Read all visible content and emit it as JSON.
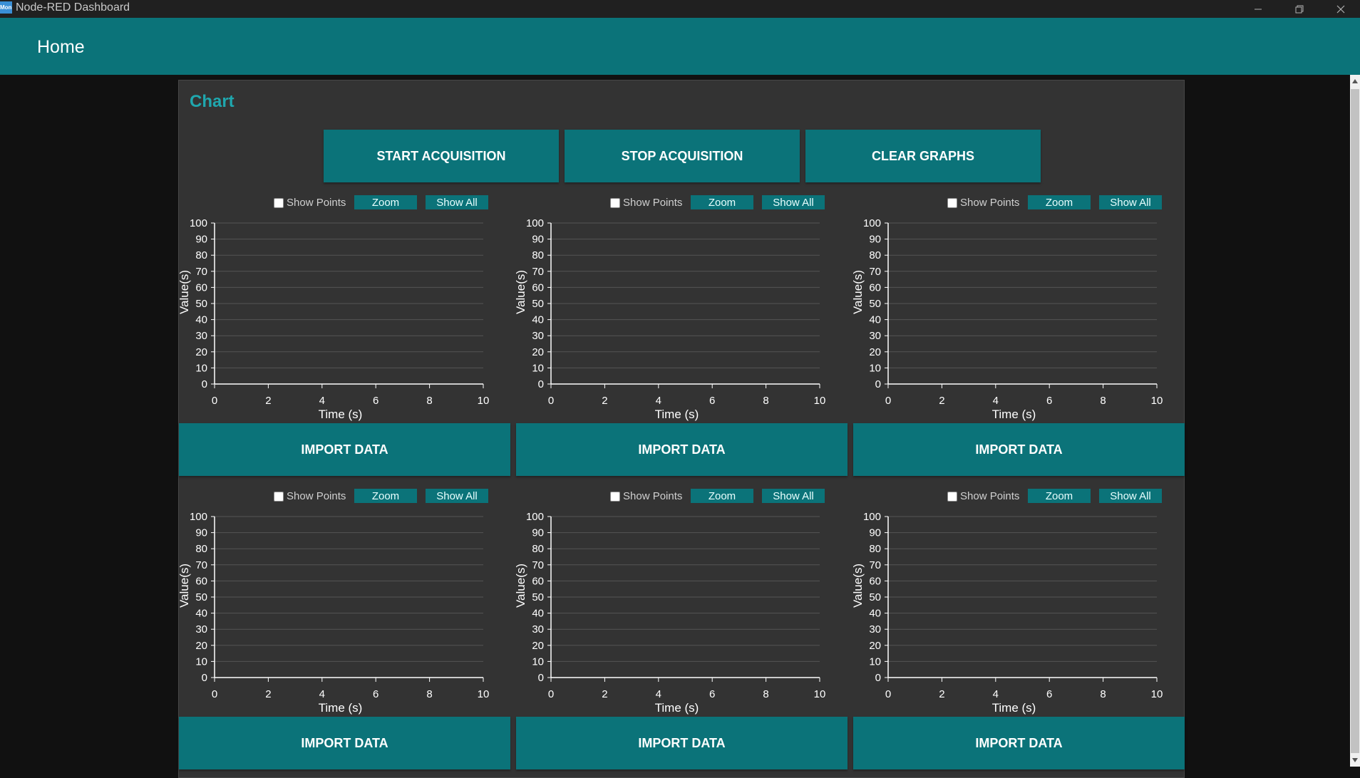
{
  "window": {
    "icon_text": "Mon",
    "title": "Node-RED Dashboard"
  },
  "header": {
    "title": "Home"
  },
  "group": {
    "title": "Chart",
    "actions": [
      {
        "label": "START ACQUISITION"
      },
      {
        "label": "STOP ACQUISITION"
      },
      {
        "label": "CLEAR GRAPHS"
      }
    ]
  },
  "chart_controls": {
    "show_points_label": "Show Points",
    "show_points_checked": false,
    "zoom_label": "Zoom",
    "show_all_label": "Show All"
  },
  "import_label": "IMPORT DATA",
  "chart_data": [
    {
      "type": "line",
      "title": "",
      "xlabel": "Time (s)",
      "ylabel": "Value(s)",
      "xlim": [
        0,
        10
      ],
      "ylim": [
        0,
        100
      ],
      "x_ticks": [
        0,
        2,
        4,
        6,
        8,
        10
      ],
      "y_ticks": [
        0,
        10,
        20,
        30,
        40,
        50,
        60,
        70,
        80,
        90,
        100
      ],
      "grid": true,
      "series": []
    },
    {
      "type": "line",
      "title": "",
      "xlabel": "Time (s)",
      "ylabel": "Value(s)",
      "xlim": [
        0,
        10
      ],
      "ylim": [
        0,
        100
      ],
      "x_ticks": [
        0,
        2,
        4,
        6,
        8,
        10
      ],
      "y_ticks": [
        0,
        10,
        20,
        30,
        40,
        50,
        60,
        70,
        80,
        90,
        100
      ],
      "grid": true,
      "series": []
    },
    {
      "type": "line",
      "title": "",
      "xlabel": "Time (s)",
      "ylabel": "Value(s)",
      "xlim": [
        0,
        10
      ],
      "ylim": [
        0,
        100
      ],
      "x_ticks": [
        0,
        2,
        4,
        6,
        8,
        10
      ],
      "y_ticks": [
        0,
        10,
        20,
        30,
        40,
        50,
        60,
        70,
        80,
        90,
        100
      ],
      "grid": true,
      "series": []
    },
    {
      "type": "line",
      "title": "",
      "xlabel": "Time (s)",
      "ylabel": "Value(s)",
      "xlim": [
        0,
        10
      ],
      "ylim": [
        0,
        100
      ],
      "x_ticks": [
        0,
        2,
        4,
        6,
        8,
        10
      ],
      "y_ticks": [
        0,
        10,
        20,
        30,
        40,
        50,
        60,
        70,
        80,
        90,
        100
      ],
      "grid": true,
      "series": []
    },
    {
      "type": "line",
      "title": "",
      "xlabel": "Time (s)",
      "ylabel": "Value(s)",
      "xlim": [
        0,
        10
      ],
      "ylim": [
        0,
        100
      ],
      "x_ticks": [
        0,
        2,
        4,
        6,
        8,
        10
      ],
      "y_ticks": [
        0,
        10,
        20,
        30,
        40,
        50,
        60,
        70,
        80,
        90,
        100
      ],
      "grid": true,
      "series": []
    },
    {
      "type": "line",
      "title": "",
      "xlabel": "Time (s)",
      "ylabel": "Value(s)",
      "xlim": [
        0,
        10
      ],
      "ylim": [
        0,
        100
      ],
      "x_ticks": [
        0,
        2,
        4,
        6,
        8,
        10
      ],
      "y_ticks": [
        0,
        10,
        20,
        30,
        40,
        50,
        60,
        70,
        80,
        90,
        100
      ],
      "grid": true,
      "series": []
    }
  ],
  "colors": {
    "accent": "#0b7379",
    "group_title": "#1fa7ae",
    "card_bg": "#333333",
    "page_bg": "#111111",
    "grid": "#555555",
    "axis": "#ffffff"
  }
}
